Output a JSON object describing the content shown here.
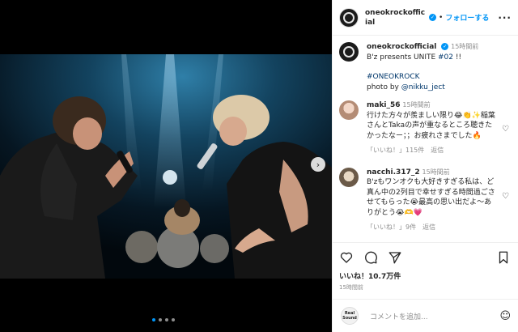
{
  "header": {
    "username": "oneokrockofficial",
    "separator": "•",
    "follow_label": "フォローする",
    "more_icon": "more-horizontal-icon"
  },
  "caption": {
    "username": "oneokrockofficial",
    "time": "15時間前",
    "line1_prefix": "B'z presents UNITE ",
    "line1_tag": "#02",
    "line1_suffix": " !!",
    "hashtag": "#ONEOKROCK",
    "photo_prefix": "photo by ",
    "photo_credit": "@nikku_ject"
  },
  "comments": [
    {
      "username": "maki_56",
      "time": "15時間前",
      "text": "行けた方々が羨ましい限り😂👏✨稲葉さんとTakaの声が重なるところ聴きたかったなー；；お疲れさまでした🔥",
      "likes": "「いいね！」115件",
      "reply": "返信"
    },
    {
      "username": "nacchi.317_2",
      "time": "15時間前",
      "text": "B'zもワンオクも大好きすぎる私は、ど真ん中の2列目で幸せすぎる時間過ごさせてもらった😭最高の思い出だよ〜ありがとう😭🫶💗",
      "likes": "「いいね！」9件",
      "reply": "返信"
    }
  ],
  "actions": {
    "likes": "いいね！10.7万件",
    "time": "15時間前"
  },
  "compose": {
    "logo_top": "Real",
    "logo_bottom": "Sound",
    "placeholder": "コメントを追加...",
    "emoji_icon": "smiley-icon"
  },
  "carousel": {
    "total": 4,
    "active": 1,
    "next_icon": "chevron-right-icon"
  },
  "colors": {
    "accent": "#0095f6",
    "link": "#00376b",
    "muted": "#8e8e8e",
    "text": "#262626"
  }
}
